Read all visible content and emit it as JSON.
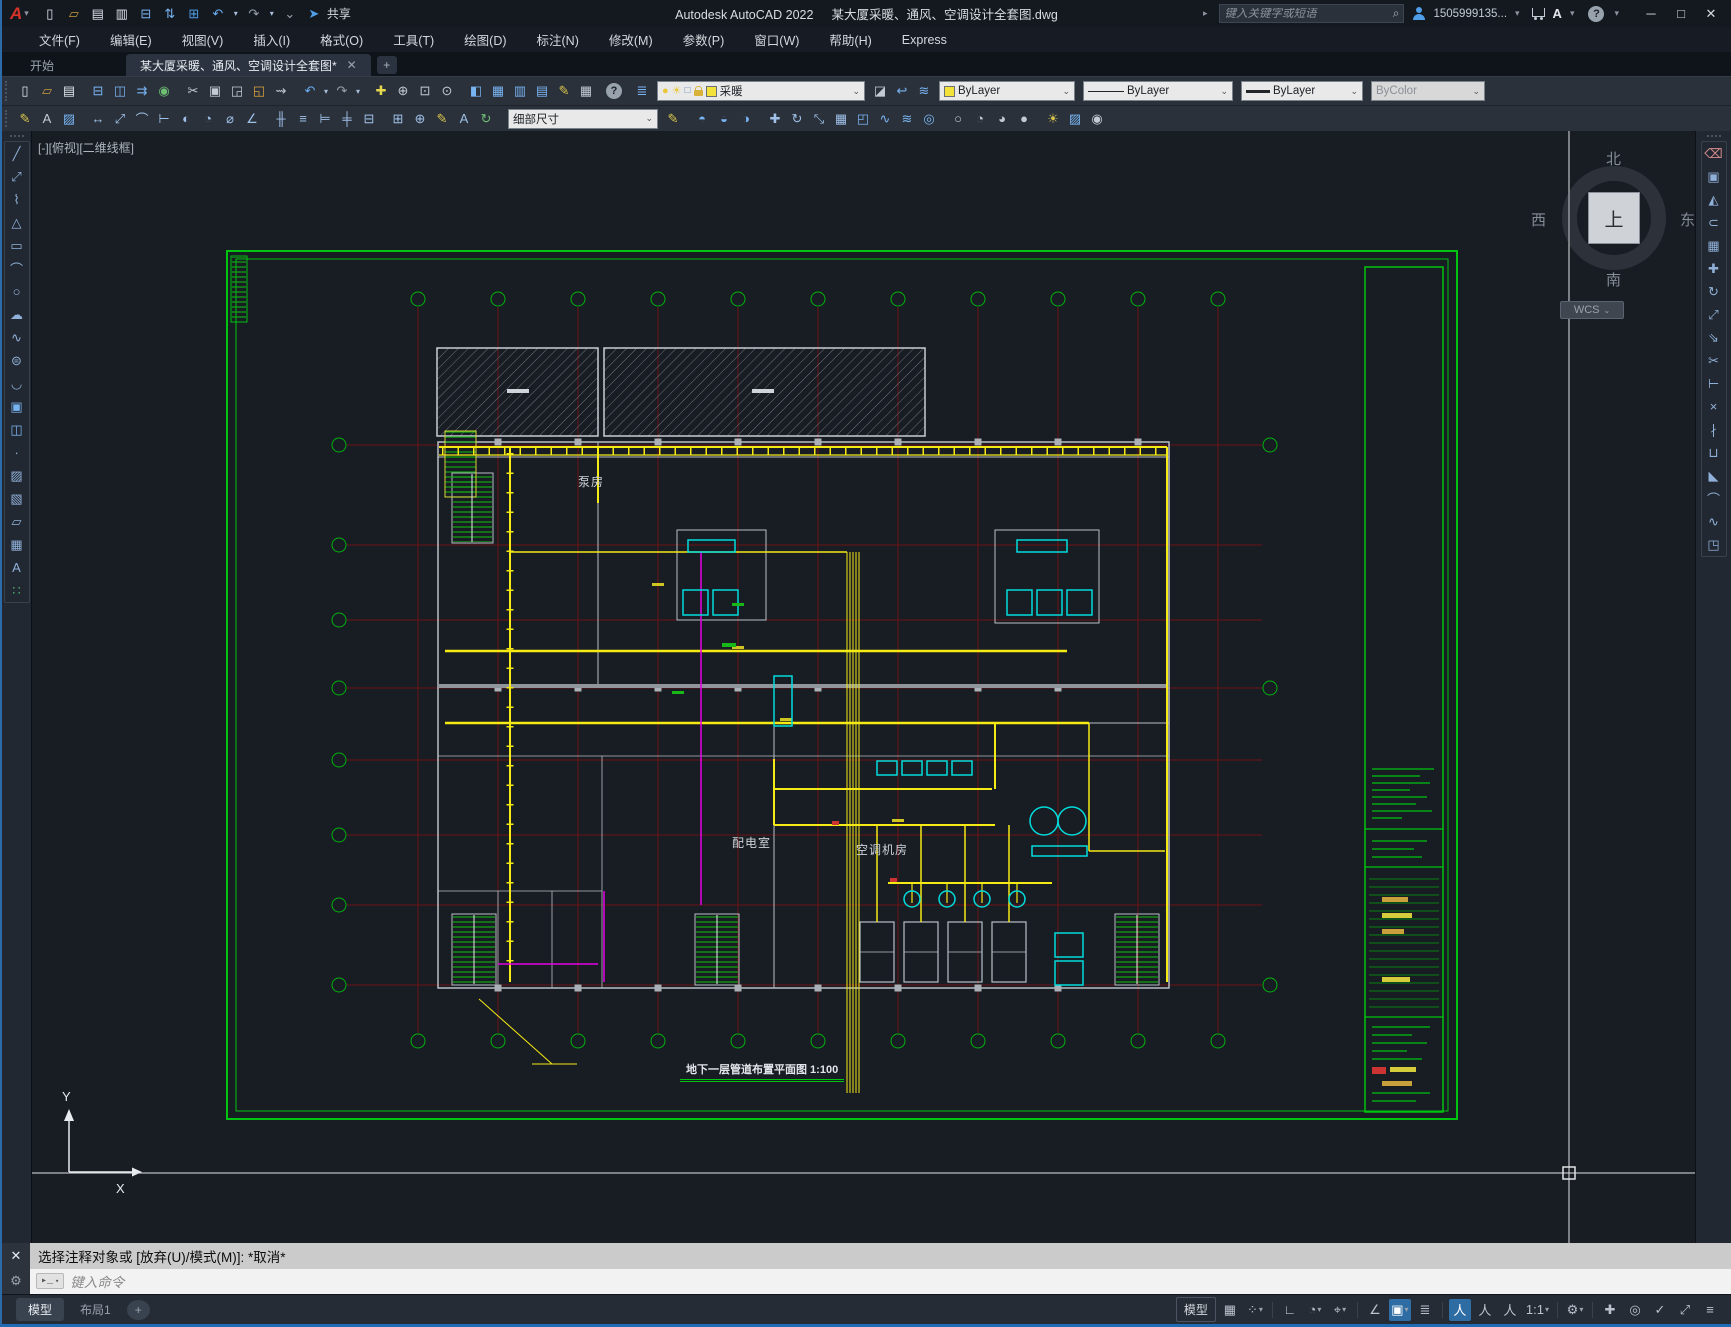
{
  "window": {
    "logo": "A",
    "app_title": "Autodesk AutoCAD 2022",
    "doc_title": "某大厦采暖、通风、空调设计全套图.dwg",
    "search_placeholder": "键入关键字或短语",
    "account": "1505999135...",
    "share_label": "共享",
    "minimize": "─",
    "maximize": "□",
    "close": "✕"
  },
  "menu": {
    "items": [
      "文件(F)",
      "编辑(E)",
      "视图(V)",
      "插入(I)",
      "格式(O)",
      "工具(T)",
      "绘图(D)",
      "标注(N)",
      "修改(M)",
      "参数(P)",
      "窗口(W)",
      "帮助(H)",
      "Express"
    ]
  },
  "tabs": {
    "start": "开始",
    "document": "某大厦采暖、通风、空调设计全套图*",
    "close_glyph": "✕",
    "new_tab": "+"
  },
  "toolbars": {
    "layer_name": "采暖",
    "color": "ByLayer",
    "linetype": "ByLayer",
    "lineweight": "ByLayer",
    "plot_style": "ByColor",
    "dim_style": "细部尺寸",
    "quick_access": [
      {
        "name": "new-file",
        "glyph": "▯",
        "color": "#dfe5ec"
      },
      {
        "name": "open-folder",
        "glyph": "▱",
        "color": "#c89b3c"
      },
      {
        "name": "save",
        "glyph": "▤",
        "color": "#dfe5ec"
      },
      {
        "name": "save-as",
        "glyph": "▥",
        "color": "#dfe5ec"
      },
      {
        "name": "plot",
        "glyph": "⊟",
        "color": "#79b4f2"
      },
      {
        "name": "transfer",
        "glyph": "⇅",
        "color": "#79b4f2"
      },
      {
        "name": "print",
        "glyph": "⊞",
        "color": "#4f9ee8"
      },
      {
        "name": "undo",
        "glyph": "↶",
        "color": "#6aaef0"
      },
      {
        "name": "undo-dropdown",
        "glyph": "▾",
        "small": true
      },
      {
        "name": "redo",
        "glyph": "↷",
        "color": "#98a2ad"
      },
      {
        "name": "redo-dropdown",
        "glyph": "▾",
        "small": true
      },
      {
        "name": "customize-dropdown",
        "glyph": "⌄",
        "color": "#98a2ad"
      },
      {
        "name": "share",
        "glyph": "➤",
        "color": "#4f9ee8"
      }
    ],
    "row1_a": [
      {
        "name": "new-file",
        "glyph": "▯",
        "color": "#dfe5ec"
      },
      {
        "name": "open",
        "glyph": "▱",
        "color": "#c89b3c"
      },
      {
        "name": "save",
        "glyph": "▤",
        "color": "#dfe5ec"
      },
      {
        "name": "separator"
      },
      {
        "name": "plot",
        "glyph": "⊟",
        "color": "#79b4f2"
      },
      {
        "name": "plot-preview",
        "glyph": "◫",
        "color": "#79b4f2"
      },
      {
        "name": "publish",
        "glyph": "⇉",
        "color": "#79b4f2"
      },
      {
        "name": "geolocation",
        "glyph": "◉",
        "color": "#6fbf73"
      },
      {
        "name": "separator"
      },
      {
        "name": "cut",
        "glyph": "✂",
        "color": "#c2cad4"
      },
      {
        "name": "copy",
        "glyph": "▣",
        "color": "#c2cad4"
      },
      {
        "name": "paste",
        "glyph": "◲",
        "color": "#c2cad4"
      },
      {
        "name": "paste-special",
        "glyph": "◱",
        "color": "#d9a23c"
      },
      {
        "name": "match-properties",
        "glyph": "⇝",
        "color": "#c2cad4"
      },
      {
        "name": "separator"
      },
      {
        "name": "undo",
        "glyph": "↶",
        "color": "#6aaef0"
      },
      {
        "name": "undo-dropdown",
        "glyph": "▾",
        "small": true
      },
      {
        "name": "redo",
        "glyph": "↷",
        "color": "#98a2ad"
      },
      {
        "name": "redo-dropdown",
        "glyph": "▾",
        "small": true
      },
      {
        "name": "separator"
      },
      {
        "name": "pan",
        "glyph": "✚",
        "color": "#e6d84e"
      },
      {
        "name": "zoom-realtime",
        "glyph": "⊕",
        "color": "#c2cad4"
      },
      {
        "name": "zoom-window",
        "glyph": "⊡",
        "color": "#c2cad4"
      },
      {
        "name": "zoom-previous",
        "glyph": "⊙",
        "color": "#c2cad4"
      },
      {
        "name": "separator"
      },
      {
        "name": "properties-palette",
        "glyph": "◧",
        "color": "#79b4f2"
      },
      {
        "name": "design-center",
        "glyph": "▦",
        "color": "#79b4f2"
      },
      {
        "name": "tool-palettes",
        "glyph": "▥",
        "color": "#79b4f2"
      },
      {
        "name": "sheet-set-manager",
        "glyph": "▤",
        "color": "#79b4f2"
      },
      {
        "name": "markup",
        "glyph": "✎",
        "color": "#d9c44c"
      },
      {
        "name": "quick-calc",
        "glyph": "▦",
        "color": "#c2cad4"
      },
      {
        "name": "separator"
      },
      {
        "name": "help",
        "glyph": "?",
        "circle": true
      },
      {
        "name": "separator"
      },
      {
        "name": "layer-properties",
        "glyph": "≣",
        "color": "#79b4f2"
      }
    ],
    "row1_b": [
      {
        "name": "make-object-layer-current",
        "glyph": "◪",
        "color": "#c2cad4"
      },
      {
        "name": "layer-previous",
        "glyph": "↩",
        "color": "#79b4f2"
      },
      {
        "name": "layer-states",
        "glyph": "≋",
        "color": "#79b4f2"
      }
    ],
    "row2_a": [
      {
        "name": "text-edit",
        "glyph": "✎",
        "color": "#d9c44c"
      },
      {
        "name": "text-style",
        "glyph": "A",
        "color": "#c2cad4"
      },
      {
        "name": "text-layers",
        "glyph": "▨",
        "color": "#79b4f2"
      },
      {
        "name": "separator"
      },
      {
        "name": "dim-linear",
        "glyph": "↔",
        "color": "#9fc0e8"
      },
      {
        "name": "dim-aligned",
        "glyph": "⤢",
        "color": "#9fc0e8"
      },
      {
        "name": "dim-arc-length",
        "glyph": "⌒",
        "color": "#9fc0e8"
      },
      {
        "name": "dim-ordinate",
        "glyph": "⊢",
        "color": "#9fc0e8"
      },
      {
        "name": "dim-radius",
        "glyph": "◐",
        "color": "#9fc0e8"
      },
      {
        "name": "dim-jogged",
        "glyph": "◔",
        "color": "#9fc0e8"
      },
      {
        "name": "dim-diameter",
        "glyph": "⌀",
        "color": "#9fc0e8"
      },
      {
        "name": "dim-angular",
        "glyph": "∠",
        "color": "#9fc0e8"
      },
      {
        "name": "separator"
      },
      {
        "name": "quick-dimension",
        "glyph": "╫",
        "color": "#9fc0e8"
      },
      {
        "name": "dim-baseline",
        "glyph": "≡",
        "color": "#9fc0e8"
      },
      {
        "name": "dim-continue",
        "glyph": "⊨",
        "color": "#9fc0e8"
      },
      {
        "name": "dim-spacing",
        "glyph": "╪",
        "color": "#9fc0e8"
      },
      {
        "name": "dim-break",
        "glyph": "⊟",
        "color": "#9fc0e8"
      },
      {
        "name": "separator"
      },
      {
        "name": "tolerance",
        "glyph": "⊞",
        "color": "#9fc0e8"
      },
      {
        "name": "center-mark",
        "glyph": "⊕",
        "color": "#9fc0e8"
      },
      {
        "name": "dim-edit",
        "glyph": "✎",
        "color": "#d9c44c"
      },
      {
        "name": "dim-text-edit",
        "glyph": "A",
        "color": "#9fc0e8"
      },
      {
        "name": "dim-update",
        "glyph": "↻",
        "color": "#6fbf73"
      },
      {
        "name": "separator"
      }
    ],
    "row2_b": [
      {
        "name": "dim-style-manager",
        "glyph": "✎",
        "color": "#d9c44c"
      },
      {
        "name": "separator"
      },
      {
        "name": "solid-union",
        "glyph": "◓",
        "color": "#79b4f2"
      },
      {
        "name": "solid-subtract",
        "glyph": "◒",
        "color": "#79b4f2"
      },
      {
        "name": "solid-intersect",
        "glyph": "◑",
        "color": "#79b4f2"
      },
      {
        "name": "separator"
      },
      {
        "name": "3d-move",
        "glyph": "✚",
        "color": "#9fc0e8"
      },
      {
        "name": "3d-rotate",
        "glyph": "↻",
        "color": "#9fc0e8"
      },
      {
        "name": "3d-align",
        "glyph": "⤡",
        "color": "#9fc0e8"
      },
      {
        "name": "3d-array",
        "glyph": "▦",
        "color": "#9fc0e8"
      },
      {
        "name": "extrude",
        "glyph": "◰",
        "color": "#79b4f2"
      },
      {
        "name": "sweep",
        "glyph": "∿",
        "color": "#79b4f2"
      },
      {
        "name": "loft",
        "glyph": "≋",
        "color": "#79b4f2"
      },
      {
        "name": "revolve",
        "glyph": "◎",
        "color": "#79b4f2"
      },
      {
        "name": "separator"
      },
      {
        "name": "vs-wireframe",
        "glyph": "○",
        "color": "#c2cad4"
      },
      {
        "name": "vs-hidden",
        "glyph": "◔",
        "color": "#c2cad4"
      },
      {
        "name": "vs-shaded",
        "glyph": "◕",
        "color": "#c2cad4"
      },
      {
        "name": "vs-realistic",
        "glyph": "●",
        "color": "#c2cad4"
      },
      {
        "name": "separator"
      },
      {
        "name": "lights",
        "glyph": "☀",
        "color": "#d9c44c"
      },
      {
        "name": "materials",
        "glyph": "▨",
        "color": "#79b4f2"
      },
      {
        "name": "render",
        "glyph": "◉",
        "color": "#c2cad4"
      }
    ],
    "draw_tools": [
      {
        "name": "line",
        "glyph": "╱"
      },
      {
        "name": "construction-line",
        "glyph": "⤢"
      },
      {
        "name": "polyline",
        "glyph": "⌇"
      },
      {
        "name": "polygon",
        "glyph": "△"
      },
      {
        "name": "rectangle",
        "glyph": "▭"
      },
      {
        "name": "arc",
        "glyph": "⌒"
      },
      {
        "name": "circle",
        "glyph": "○"
      },
      {
        "name": "revision-cloud",
        "glyph": "☁"
      },
      {
        "name": "spline",
        "glyph": "∿"
      },
      {
        "name": "ellipse",
        "glyph": "⊜"
      },
      {
        "name": "ellipse-arc",
        "glyph": "◡"
      },
      {
        "name": "insert-block",
        "glyph": "▣",
        "color": "#79b4f2"
      },
      {
        "name": "make-block",
        "glyph": "◫",
        "color": "#79b4f2"
      },
      {
        "name": "point",
        "glyph": "∙"
      },
      {
        "name": "hatch",
        "glyph": "▨"
      },
      {
        "name": "gradient",
        "glyph": "▧"
      },
      {
        "name": "region",
        "glyph": "▱"
      },
      {
        "name": "table",
        "glyph": "▦"
      },
      {
        "name": "mtext",
        "glyph": "A"
      },
      {
        "name": "point-cloud",
        "glyph": "∷",
        "color": "#4fb06a"
      }
    ],
    "modify_tools": [
      {
        "name": "erase",
        "glyph": "⌫",
        "color": "#d98c8c"
      },
      {
        "name": "copy",
        "glyph": "▣"
      },
      {
        "name": "mirror",
        "glyph": "◭"
      },
      {
        "name": "offset",
        "glyph": "⊂"
      },
      {
        "name": "array",
        "glyph": "▦"
      },
      {
        "name": "move",
        "glyph": "✚"
      },
      {
        "name": "rotate",
        "glyph": "↻"
      },
      {
        "name": "scale",
        "glyph": "⤢"
      },
      {
        "name": "stretch",
        "glyph": "⇘"
      },
      {
        "name": "trim",
        "glyph": "✂"
      },
      {
        "name": "extend",
        "glyph": "⊢"
      },
      {
        "name": "break-at-point",
        "glyph": "×"
      },
      {
        "name": "break",
        "glyph": "∤"
      },
      {
        "name": "join",
        "glyph": "⊔"
      },
      {
        "name": "chamfer",
        "glyph": "◣"
      },
      {
        "name": "fillet",
        "glyph": "⌒"
      },
      {
        "name": "blend-curves",
        "glyph": "∿"
      },
      {
        "name": "box",
        "glyph": "◳"
      }
    ]
  },
  "canvas": {
    "viewport_label": "[-][俯视][二维线框]",
    "viewcube": {
      "north": "北",
      "south": "南",
      "west": "西",
      "east": "东",
      "top": "上",
      "wcs": "WCS"
    },
    "ucs": {
      "x_label": "X",
      "y_label": "Y"
    },
    "plan": {
      "room_pump": "泵房",
      "room_power": "配电室",
      "room_ahu": "空调机房",
      "sheet_title": "地下一层管道布置平面图 1:100"
    }
  },
  "command_line": {
    "close_glyph": "✕",
    "tools_glyph": "⚙",
    "chip": "▸_",
    "history": "选择注释对象或 [放弃(U)/模式(M)]: *取消*",
    "prompt_placeholder": "键入命令"
  },
  "status_bar": {
    "model_tab": "模型",
    "layout_tab": "布局1",
    "add_layout": "+",
    "items": [
      {
        "name": "model-space",
        "label": "模型"
      },
      {
        "name": "grid-display",
        "glyph": "▦"
      },
      {
        "name": "snap-mode",
        "glyph": "⁘",
        "dd": true
      },
      {
        "name": "sep"
      },
      {
        "name": "ortho-mode",
        "glyph": "∟"
      },
      {
        "name": "polar-tracking",
        "glyph": "◔",
        "dd": true
      },
      {
        "name": "object-snap",
        "glyph": "⌖",
        "dd": true
      },
      {
        "name": "sep"
      },
      {
        "name": "isometric-drafting",
        "glyph": "∠"
      },
      {
        "name": "dynamic-input",
        "glyph": "▣",
        "active": true,
        "dd": true
      },
      {
        "name": "lineweight-display",
        "glyph": "≣"
      },
      {
        "name": "sep"
      },
      {
        "name": "annotation-visibility",
        "glyph": "人",
        "active": true
      },
      {
        "name": "annotation-autoscale",
        "glyph": "人"
      },
      {
        "name": "annotation-scale-all",
        "glyph": "人"
      },
      {
        "name": "annotation-scale",
        "label": "1:1",
        "dd": true
      },
      {
        "name": "sep"
      },
      {
        "name": "workspace-switching",
        "glyph": "⚙",
        "dd": true
      },
      {
        "name": "sep"
      },
      {
        "name": "crosshair-toggle",
        "glyph": "✚"
      },
      {
        "name": "object-isolate",
        "glyph": "◎"
      },
      {
        "name": "graphics-performance",
        "glyph": "✓",
        "active": false
      },
      {
        "name": "clean-screen",
        "glyph": "⤢"
      },
      {
        "name": "customization",
        "glyph": "≡"
      }
    ]
  }
}
